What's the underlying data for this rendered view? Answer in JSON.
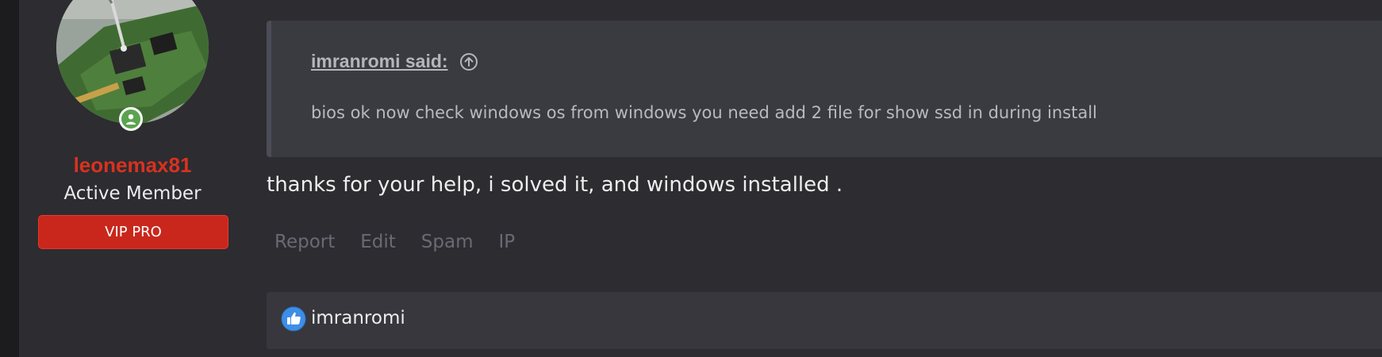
{
  "user": {
    "name": "leonemax81",
    "title": "Active Member",
    "banner": "VIP PRO",
    "online": true
  },
  "quote": {
    "author_label": "imranromi said:",
    "text": "bios ok now check windows os from windows you need add 2 file for show ssd in during install"
  },
  "post": {
    "text": "thanks for your help, i solved it, and windows installed ."
  },
  "actions": {
    "report": "Report",
    "edit": "Edit",
    "spam": "Spam",
    "ip": "IP"
  },
  "reactions": {
    "icon": "like-icon",
    "users": "imranromi"
  },
  "colors": {
    "username": "#d8321f",
    "banner_bg": "#c9271c",
    "online": "#5aa34f",
    "background": "#2c2c31",
    "quote_bg": "#3a3a41"
  }
}
